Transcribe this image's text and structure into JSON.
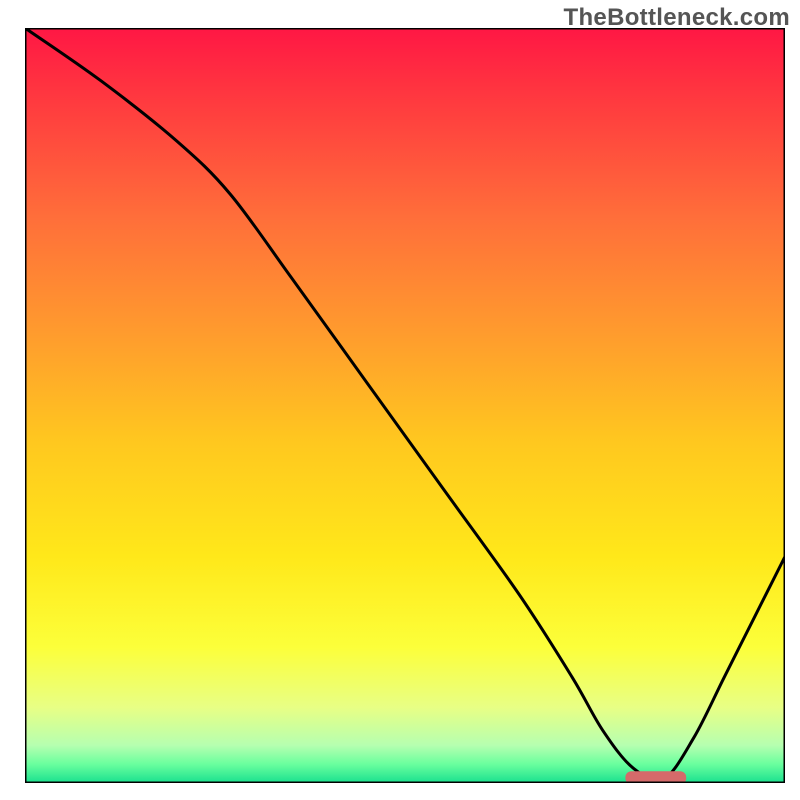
{
  "watermark": "TheBottleneck.com",
  "chart_data": {
    "type": "line",
    "title": "",
    "xlabel": "",
    "ylabel": "",
    "xlim": [
      0,
      100
    ],
    "ylim": [
      0,
      100
    ],
    "grid": false,
    "legend": false,
    "series": [
      {
        "name": "curve",
        "x": [
          0,
          10,
          20,
          27,
          35,
          45,
          55,
          65,
          72,
          76,
          80,
          84,
          88,
          92,
          96,
          100
        ],
        "values": [
          100,
          93,
          85,
          78,
          67,
          53,
          39,
          25,
          14,
          7,
          2,
          0.5,
          6,
          14,
          22,
          30
        ]
      }
    ],
    "marker": {
      "name": "optimum-marker",
      "x_start": 79,
      "x_end": 87,
      "y": 0.7,
      "color": "#d56a6a"
    },
    "background_gradient": {
      "stops": [
        {
          "offset": 0.0,
          "color": "#ff1744"
        },
        {
          "offset": 0.1,
          "color": "#ff3b3f"
        },
        {
          "offset": 0.25,
          "color": "#ff6e3a"
        },
        {
          "offset": 0.4,
          "color": "#ff9a2e"
        },
        {
          "offset": 0.55,
          "color": "#ffc81f"
        },
        {
          "offset": 0.7,
          "color": "#ffe81a"
        },
        {
          "offset": 0.82,
          "color": "#fcff3a"
        },
        {
          "offset": 0.9,
          "color": "#e8ff85"
        },
        {
          "offset": 0.95,
          "color": "#b6ffb0"
        },
        {
          "offset": 0.975,
          "color": "#6aff9e"
        },
        {
          "offset": 1.0,
          "color": "#19e08f"
        }
      ]
    }
  }
}
